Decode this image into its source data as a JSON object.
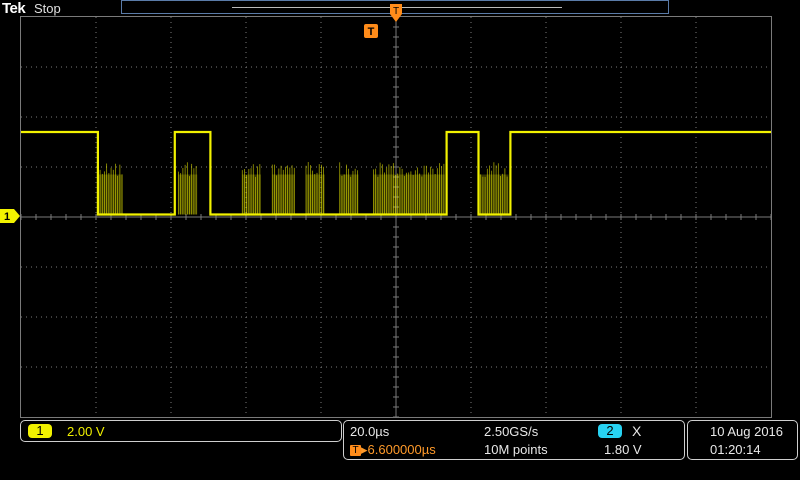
{
  "header": {
    "brand": "Tek",
    "status": "Stop"
  },
  "colors": {
    "trace": "#f2f200",
    "grid": "#7a7a7a",
    "trigger": "#ff8c1a",
    "ch2": "#27d2f2",
    "background": "#000000"
  },
  "markers": {
    "trigger_label": "T",
    "channel_marker": "1"
  },
  "bottom": {
    "channel": {
      "number": "1",
      "scale": "2.00 V"
    },
    "timebase": {
      "scale": "20.0µs",
      "sample_rate": "2.50GS/s",
      "trigger_delay": "▸6.600000µs",
      "record_length": "10M points"
    },
    "trigger": {
      "source": "2",
      "slope_icon": "X",
      "level": "1.80 V"
    },
    "datetime": {
      "date": "10 Aug 2016",
      "time": "01:20:14"
    }
  },
  "chart_data": {
    "type": "line",
    "title": "",
    "xlabel": "",
    "ylabel": "",
    "x_unit": "µs",
    "y_unit": "V",
    "xlim": [
      -100,
      100
    ],
    "ylim": [
      -8,
      8
    ],
    "grid": true,
    "divisions": {
      "x": 10,
      "y": 8
    },
    "series": [
      {
        "name": "",
        "color": "#f2f200",
        "x": [
          -100,
          -79.5,
          -79.5,
          -59,
          -59,
          -49.5,
          -49.5,
          13.5,
          13.5,
          22,
          22,
          30.5,
          30.5,
          100
        ],
        "y": [
          3.4,
          3.4,
          0.1,
          0.1,
          3.4,
          3.4,
          0.1,
          0.1,
          3.4,
          3.4,
          0.1,
          0.1,
          3.4,
          3.4
        ]
      }
    ],
    "burst_regions_us": [
      [
        -79.5,
        -73
      ],
      [
        -58,
        -53
      ],
      [
        -41,
        -36
      ],
      [
        -33,
        -27
      ],
      [
        -24,
        -19
      ],
      [
        -15,
        -10
      ],
      [
        -6,
        13
      ],
      [
        22,
        30
      ]
    ]
  }
}
